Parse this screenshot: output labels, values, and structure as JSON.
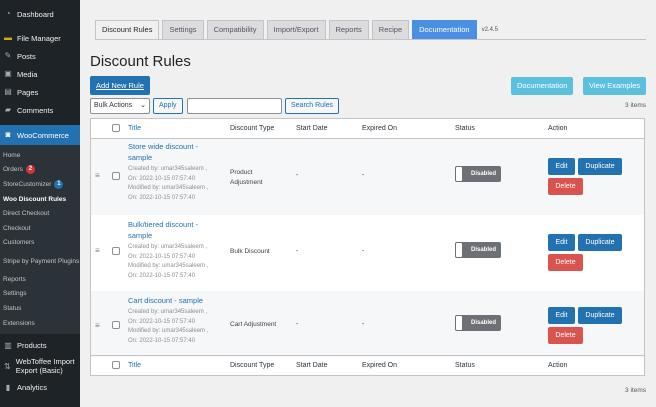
{
  "sidebar": {
    "top": [
      {
        "label": "Dashboard",
        "icon": "dashboard-icon"
      },
      {
        "label": "File Manager",
        "icon": "folder-icon"
      },
      {
        "label": "Posts",
        "icon": "pin-icon"
      },
      {
        "label": "Media",
        "icon": "media-icon"
      },
      {
        "label": "Pages",
        "icon": "pages-icon"
      },
      {
        "label": "Comments",
        "icon": "comments-icon"
      }
    ],
    "woocommerce": {
      "label": "WooCommerce",
      "icon": "woocommerce-icon"
    },
    "sub": [
      {
        "label": "Home"
      },
      {
        "label": "Orders",
        "badge": "2"
      },
      {
        "label": "StoreCustomizer",
        "badge": "1"
      },
      {
        "label": "Woo Discount Rules"
      },
      {
        "label": "Direct Checkout"
      },
      {
        "label": "Checkout"
      },
      {
        "label": "Customers"
      },
      {
        "label": "Stripe by Payment Plugins"
      },
      {
        "label": "Reports"
      },
      {
        "label": "Settings"
      },
      {
        "label": "Status"
      },
      {
        "label": "Extensions"
      }
    ],
    "bottom": [
      {
        "label": "Products",
        "icon": "products-icon"
      },
      {
        "label": "WebToffee Import Export (Basic)",
        "icon": "import-export-icon"
      },
      {
        "label": "Analytics",
        "icon": "analytics-icon"
      }
    ]
  },
  "tabs": [
    "Discount Rules",
    "Settings",
    "Compatibility",
    "Import/Export",
    "Reports",
    "Recipe",
    "Documentation"
  ],
  "version": "v2.4.5",
  "page": {
    "title": "Discount Rules",
    "add_new": "Add New Rule",
    "documentation": "Documentation",
    "view_examples": "View Examples",
    "bulk_actions": "Bulk Actions",
    "apply": "Apply",
    "search_value": "",
    "search_rules": "Search Rules",
    "items_count": "3 items"
  },
  "table": {
    "columns": {
      "title": "Title",
      "discount_type": "Discount Type",
      "start_date": "Start Date",
      "expired_on": "Expired On",
      "status": "Status",
      "action": "Action"
    },
    "rows": [
      {
        "title": "Store wide discount - sample",
        "created_by": "Created by: umar345saleem ,",
        "created_on": "On: 2022-10-15 07:57:40",
        "modified_by": "Modified by: umar345saleem ,",
        "modified_on": "On: 2022-10-15 07:57:40",
        "type": "Product Adjustment",
        "start": "-",
        "expired": "-",
        "status": "Disabled",
        "edit": "Edit",
        "duplicate": "Duplicate",
        "delete": "Delete"
      },
      {
        "title": "Bulk/tiered discount - sample",
        "created_by": "Created by: umar345saleem ,",
        "created_on": "On: 2022-10-15 07:57:40",
        "modified_by": "Modified by: umar345saleem ,",
        "modified_on": "On: 2022-10-15 07:57:40",
        "type": "Bulk Discount",
        "start": "-",
        "expired": "-",
        "status": "Disabled",
        "edit": "Edit",
        "duplicate": "Duplicate",
        "delete": "Delete"
      },
      {
        "title": "Cart discount - sample",
        "created_by": "Created by: umar345saleem ,",
        "created_on": "On: 2022-10-15 07:57:40",
        "modified_by": "Modified by: umar345saleem ,",
        "modified_on": "On: 2022-10-15 07:57:40",
        "type": "Cart Adjustment",
        "start": "-",
        "expired": "-",
        "status": "Disabled",
        "edit": "Edit",
        "duplicate": "Duplicate",
        "delete": "Delete"
      }
    ]
  },
  "colors": {
    "sidebar_bg": "#1d2327",
    "accent": "#2271b1",
    "docs_button": "#5bc0de",
    "delete_button": "#d9534f",
    "badge_red": "#d63638"
  }
}
